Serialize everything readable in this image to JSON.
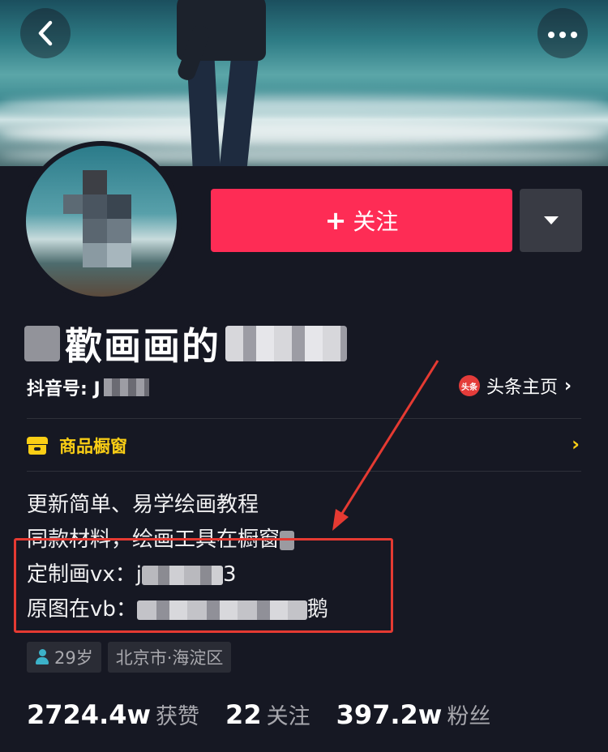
{
  "header": {
    "back_icon": "back-chevron-icon",
    "more_icon": "more-dots-icon"
  },
  "actions": {
    "follow_plus": "+",
    "follow_label": "关注",
    "dropdown_icon": "caret-down-icon"
  },
  "profile": {
    "name_visible": "歡画画的",
    "id_label": "抖音号: J",
    "toutiao_badge": "头条",
    "toutiao_label": "头条主页",
    "toutiao_chevron": "›"
  },
  "shop": {
    "label": "商品橱窗",
    "chevron": "›",
    "accent_color": "#face15"
  },
  "bio": {
    "line1": "更新简单、易学绘画教程",
    "line2": "同款材料，绘画工具在橱窗",
    "line3_prefix": "定制画vx：j",
    "line3_suffix": "3",
    "line4_prefix": "原图在vb：",
    "line4_suffix": "鹅"
  },
  "tags": {
    "age": "29岁",
    "location": "北京市·海淀区"
  },
  "stats": {
    "likes_value": "2724.4w",
    "likes_label": "获赞",
    "following_value": "22",
    "following_label": "关注",
    "followers_value": "397.2w",
    "followers_label": "粉丝"
  },
  "colors": {
    "background": "#161823",
    "follow_button": "#fe2c55",
    "annotation": "#e53a32"
  }
}
